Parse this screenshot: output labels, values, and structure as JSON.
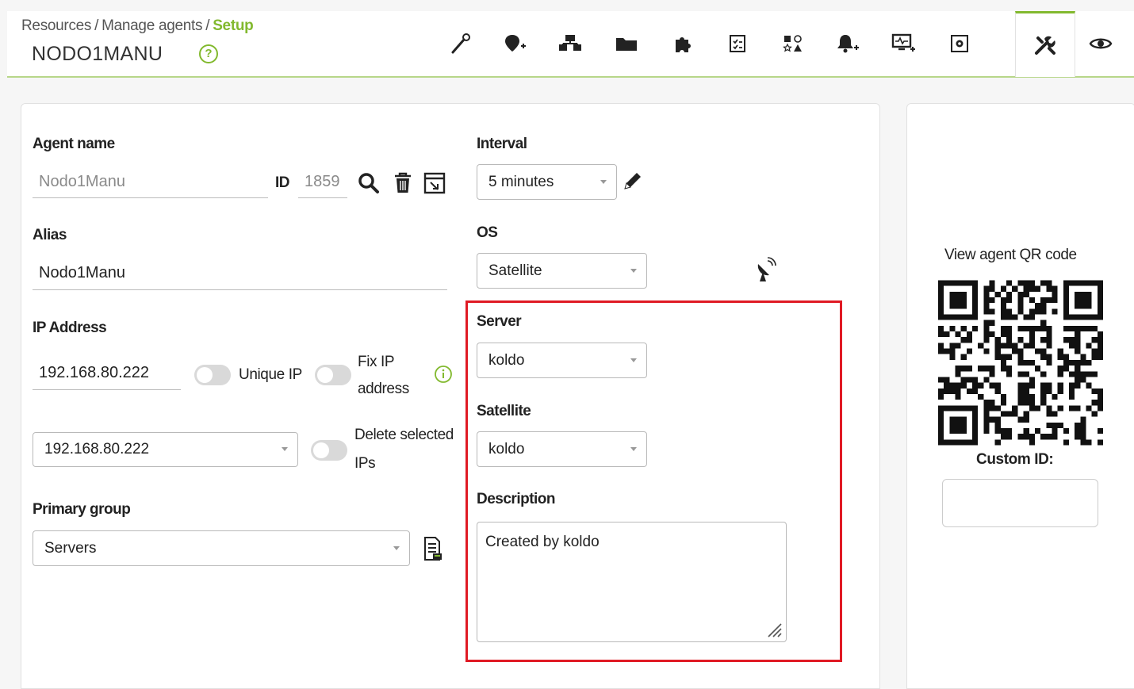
{
  "breadcrumb": {
    "items": [
      "Resources",
      "Manage agents"
    ],
    "separator": "/",
    "current": "Setup"
  },
  "header": {
    "title": "NODO1MANU",
    "help_icon": "question-circle-icon",
    "tabs": [
      {
        "name": "tab-wand",
        "icon": "wand-icon"
      },
      {
        "name": "tab-alerts-add",
        "icon": "location-plus-icon"
      },
      {
        "name": "tab-network",
        "icon": "network-icon"
      },
      {
        "name": "tab-folder",
        "icon": "folder-icon"
      },
      {
        "name": "tab-plugins",
        "icon": "puzzle-icon"
      },
      {
        "name": "tab-checklist",
        "icon": "checklist-icon"
      },
      {
        "name": "tab-shapes",
        "icon": "shapes-icon"
      },
      {
        "name": "tab-bell-add",
        "icon": "bell-plus-icon"
      },
      {
        "name": "tab-monitor-add",
        "icon": "monitor-plus-icon"
      },
      {
        "name": "tab-settings-box",
        "icon": "settings-box-icon"
      },
      {
        "name": "tab-setup",
        "icon": "tools-icon",
        "active": true
      },
      {
        "name": "tab-view",
        "icon": "eye-icon"
      }
    ]
  },
  "form": {
    "agent_name": {
      "label": "Agent name",
      "value": "Nodo1Manu"
    },
    "id": {
      "label": "ID",
      "value": "1859"
    },
    "alias": {
      "label": "Alias",
      "value": "Nodo1Manu"
    },
    "ip_address": {
      "label": "IP Address",
      "value": "192.168.80.222",
      "unique_ip_label": "Unique IP",
      "fix_ip_label_1": "Fix IP",
      "fix_ip_label_2": "address",
      "selected_ip": "192.168.80.222",
      "delete_label_1": "Delete selected",
      "delete_label_2": "IPs"
    },
    "primary_group": {
      "label": "Primary group",
      "value": "Servers"
    },
    "interval": {
      "label": "Interval",
      "value": "5 minutes"
    },
    "os": {
      "label": "OS",
      "value": "Satellite"
    },
    "server": {
      "label": "Server",
      "value": "koldo"
    },
    "satellite": {
      "label": "Satellite",
      "value": "koldo"
    },
    "description": {
      "label": "Description",
      "value": "Created by koldo"
    }
  },
  "side_panel": {
    "qr_title": "View agent QR code",
    "custom_id_label": "Custom ID:",
    "custom_id_value": ""
  },
  "colors": {
    "accent": "#82b92e",
    "highlight": "#e01a24",
    "background": "#f6f6f6"
  }
}
